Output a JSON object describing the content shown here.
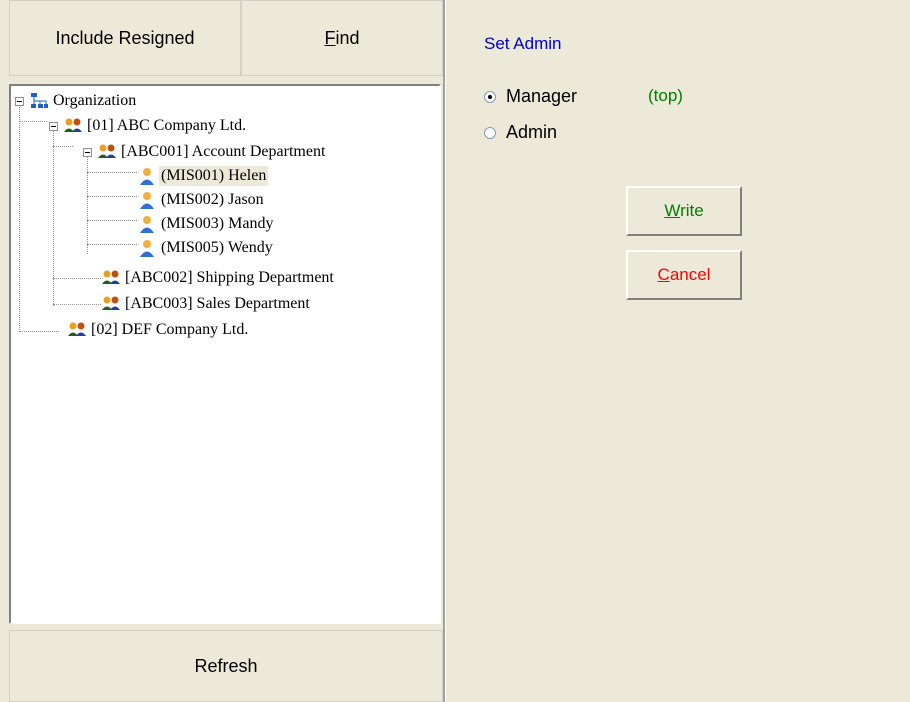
{
  "toolbar": {
    "include_resigned_label": "Include Resigned",
    "find_label": "Find",
    "refresh_label": "Refresh"
  },
  "tree": {
    "root": {
      "label": "Organization",
      "icon": "org-chart-icon"
    },
    "companies": [
      {
        "label": "[01]  ABC Company Ltd.",
        "departments": [
          {
            "label": "[ABC001]  Account Department",
            "members": [
              {
                "label": "(MIS001)  Helen",
                "selected": true
              },
              {
                "label": "(MIS002)  Jason"
              },
              {
                "label": "(MIS003)  Mandy"
              },
              {
                "label": "(MIS005)  Wendy"
              }
            ]
          },
          {
            "label": "[ABC002]  Shipping Department"
          },
          {
            "label": "[ABC003]  Sales Department"
          }
        ]
      },
      {
        "label": "[02]  DEF Company Ltd."
      }
    ]
  },
  "admin": {
    "title": "Set Admin",
    "options": [
      {
        "label": "Manager",
        "checked": true
      },
      {
        "label": "Admin",
        "checked": false
      }
    ],
    "note": "(top)",
    "write_label": "Write",
    "cancel_label": "Cancel"
  },
  "colors": {
    "background": "#ece9d8",
    "title_blue": "#0000cc",
    "note_green": "#008000",
    "write_green": "#008000",
    "cancel_red": "#ff0000"
  }
}
